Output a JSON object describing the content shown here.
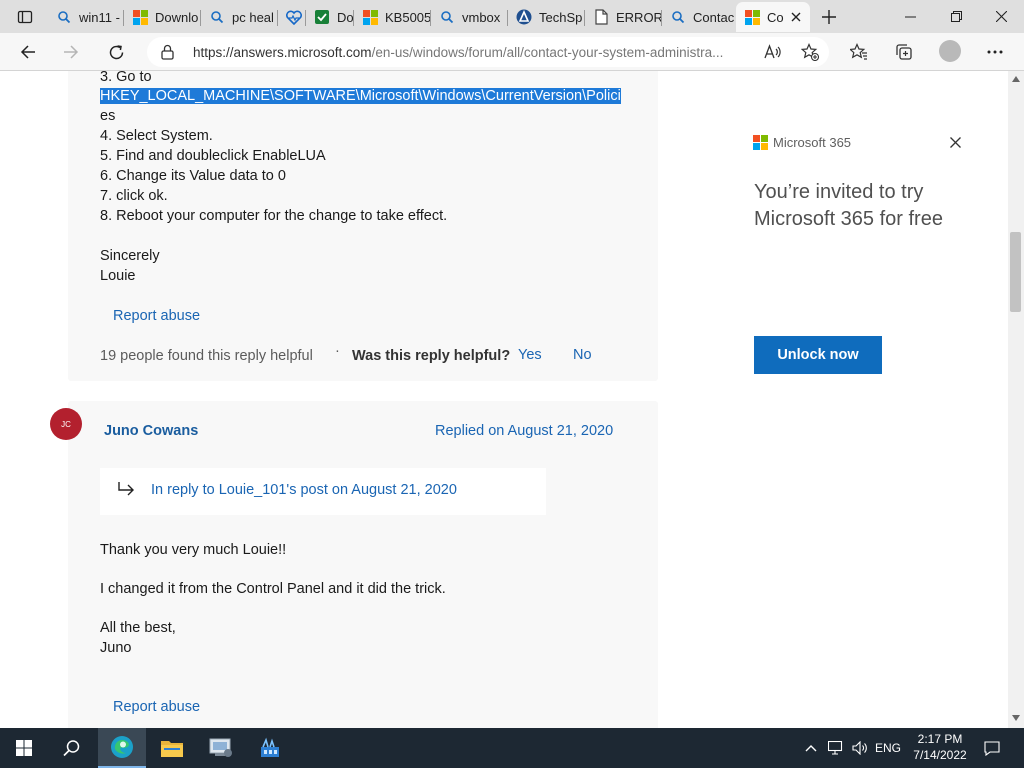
{
  "browser": {
    "tabs": [
      {
        "title": "win11 -",
        "icon": "search-icon"
      },
      {
        "title": "Downlo",
        "icon": "windows-logo-icon"
      },
      {
        "title": "pc heal",
        "icon": "search-icon"
      },
      {
        "title": "",
        "icon": "heart-health-icon"
      },
      {
        "title": "Dov",
        "icon": "checkbox-icon"
      },
      {
        "title": "KB5005",
        "icon": "windows-logo-icon"
      },
      {
        "title": "vmbox",
        "icon": "search-icon"
      },
      {
        "title": "TechSp",
        "icon": "techspot-icon"
      },
      {
        "title": "ERROR",
        "icon": "document-icon"
      },
      {
        "title": "Contac",
        "icon": "search-icon"
      },
      {
        "title": "Co",
        "icon": "microsoft-logo-icon"
      }
    ],
    "url_main": "https://answers.microsoft.com",
    "url_rest": "/en-us/windows/forum/all/contact-your-system-administra..."
  },
  "post1": {
    "step3": "3. Go to",
    "registry_path": "HKEY_LOCAL_MACHINE\\SOFTWARE\\Microsoft\\Windows\\CurrentVersion\\Polici",
    "registry_path_end": "es",
    "step4": "4. Select System.",
    "step5": "5. Find and doubleclick EnableLUA",
    "step6": "6. Change its Value data to 0",
    "step7": "7. click ok.",
    "step8": "8. Reboot your computer for the change to take effect.",
    "closing": "Sincerely",
    "signature": "Louie",
    "report_abuse": "Report abuse",
    "helpful_count": "19 people found this reply helpful",
    "dot": "·",
    "helpful_question": "Was this reply helpful?",
    "yes": "Yes",
    "no": "No"
  },
  "post2": {
    "avatar_initials": "JC",
    "author": "Juno Cowans",
    "replied_on": "Replied on August 21, 2020",
    "in_reply_to": "In reply to Louie_101's post on August 21, 2020",
    "line1": "Thank you very much Louie!!",
    "line2": "I changed it from the Control Panel and it did the trick.",
    "line3": "All the best,",
    "signature": "Juno",
    "report_abuse": "Report abuse"
  },
  "ad": {
    "brand": "Microsoft 365",
    "headline": "You’re invited to try Microsoft 365 for free",
    "button": "Unlock now"
  },
  "taskbar": {
    "language": "ENG",
    "time": "2:17 PM",
    "date": "7/14/2022"
  },
  "colors": {
    "link": "#1a65b3",
    "selection": "#1e7ad8",
    "button": "#0f6cbd",
    "avatar": "#b3202e",
    "taskbar": "#1d2833"
  }
}
